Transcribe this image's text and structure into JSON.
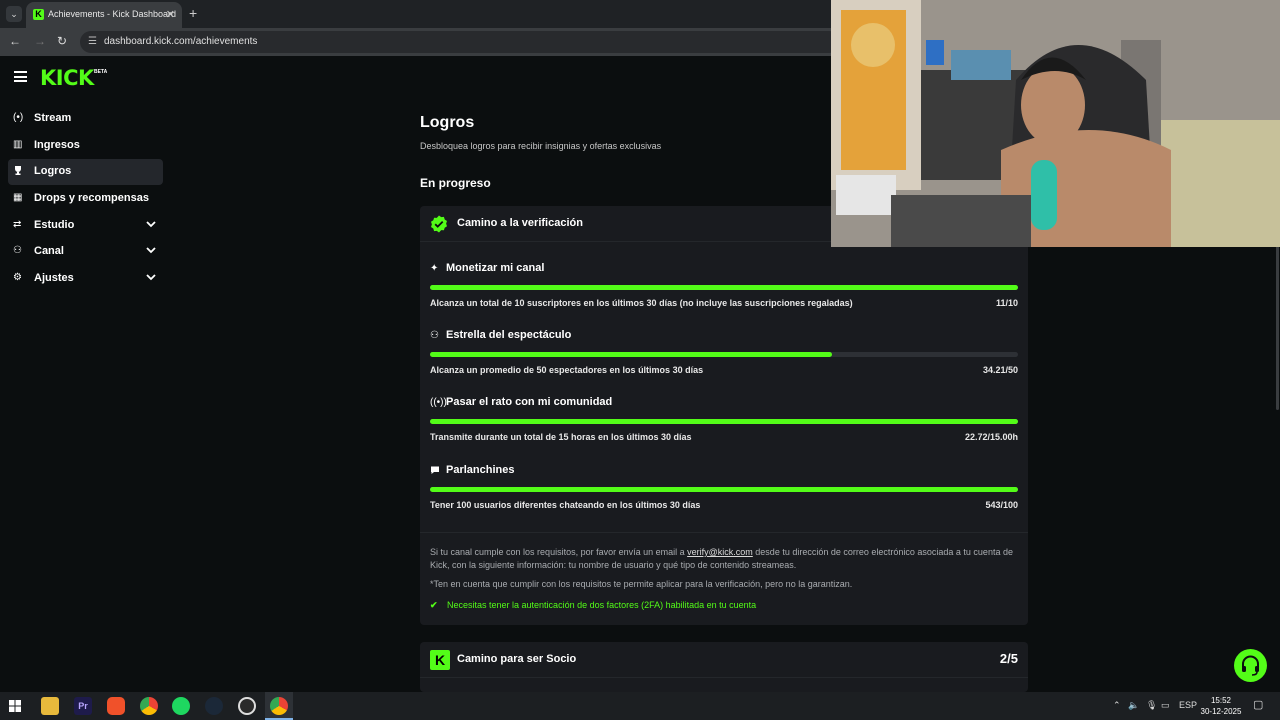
{
  "browser": {
    "tab_title": "Achievements - Kick Dashboard",
    "url": "dashboard.kick.com/achievements"
  },
  "brand": {
    "logo": "KICK",
    "beta": "BETA",
    "accent": "#53fc18"
  },
  "sidebar": {
    "items": [
      {
        "label": "Stream",
        "icon": "broadcast-icon",
        "glyph": "(•)"
      },
      {
        "label": "Ingresos",
        "icon": "chart-icon",
        "glyph": "▥"
      },
      {
        "label": "Logros",
        "icon": "trophy-icon",
        "glyph": "🏆"
      },
      {
        "label": "Drops y recompensas",
        "icon": "gift-icon",
        "glyph": "▦"
      },
      {
        "label": "Estudio",
        "icon": "sliders-icon",
        "glyph": "⇄"
      },
      {
        "label": "Canal",
        "icon": "users-icon",
        "glyph": "⚇"
      },
      {
        "label": "Ajustes",
        "icon": "gear-icon",
        "glyph": "⚙"
      }
    ]
  },
  "page": {
    "title": "Logros",
    "subtitle": "Desbloquea logros para recibir insignias y ofertas exclusivas",
    "section": "En progreso"
  },
  "verification": {
    "title": "Camino a la verificación",
    "tasks": [
      {
        "icon": "sparkle-icon",
        "glyph": "✦",
        "name": "Monetizar mi canal",
        "desc": "Alcanza un total de 10 suscriptores en los últimos 30 días (no incluye las suscripciones regaladas)",
        "value": "11/10",
        "progress": 1.0
      },
      {
        "icon": "star-person-icon",
        "glyph": "⚇",
        "name": "Estrella del espectáculo",
        "desc": "Alcanza un promedio de 50 espectadores en los últimos 30 días",
        "value": "34.21/50",
        "progress": 0.684
      },
      {
        "icon": "broadcast-icon",
        "glyph": "((•))",
        "name": "Pasar el rato con mi comunidad",
        "desc": "Transmite durante un total de 15 horas en los últimos 30 días",
        "value": "22.72/15.00h",
        "progress": 1.0
      },
      {
        "icon": "chat-icon",
        "glyph": "●",
        "name": "Parlanchines",
        "desc": "Tener 100 usuarios diferentes chateando en los últimos 30 días",
        "value": "543/100",
        "progress": 1.0
      }
    ],
    "note_part1": "Si tu canal cumple con los requisitos, por favor envía un email a ",
    "email": "verify@kick.com",
    "note_part2": " desde tu dirección de correo electrónico asociada a tu cuenta de Kick, con la siguiente información: tu nombre de usuario y qué tipo de contenido streameas.",
    "disclaimer": "*Ten en cuenta que cumplir con los requisitos te permite aplicar para la verificación, pero no la garantizan.",
    "requirement": "Necesitas tener la autenticación de dos factores (2FA) habilitada en tu cuenta"
  },
  "partner": {
    "title": "Camino para ser Socio",
    "count": "2/5"
  },
  "taskbar": {
    "lang": "ESP",
    "time": "15:52",
    "date": "30-12-2025"
  }
}
